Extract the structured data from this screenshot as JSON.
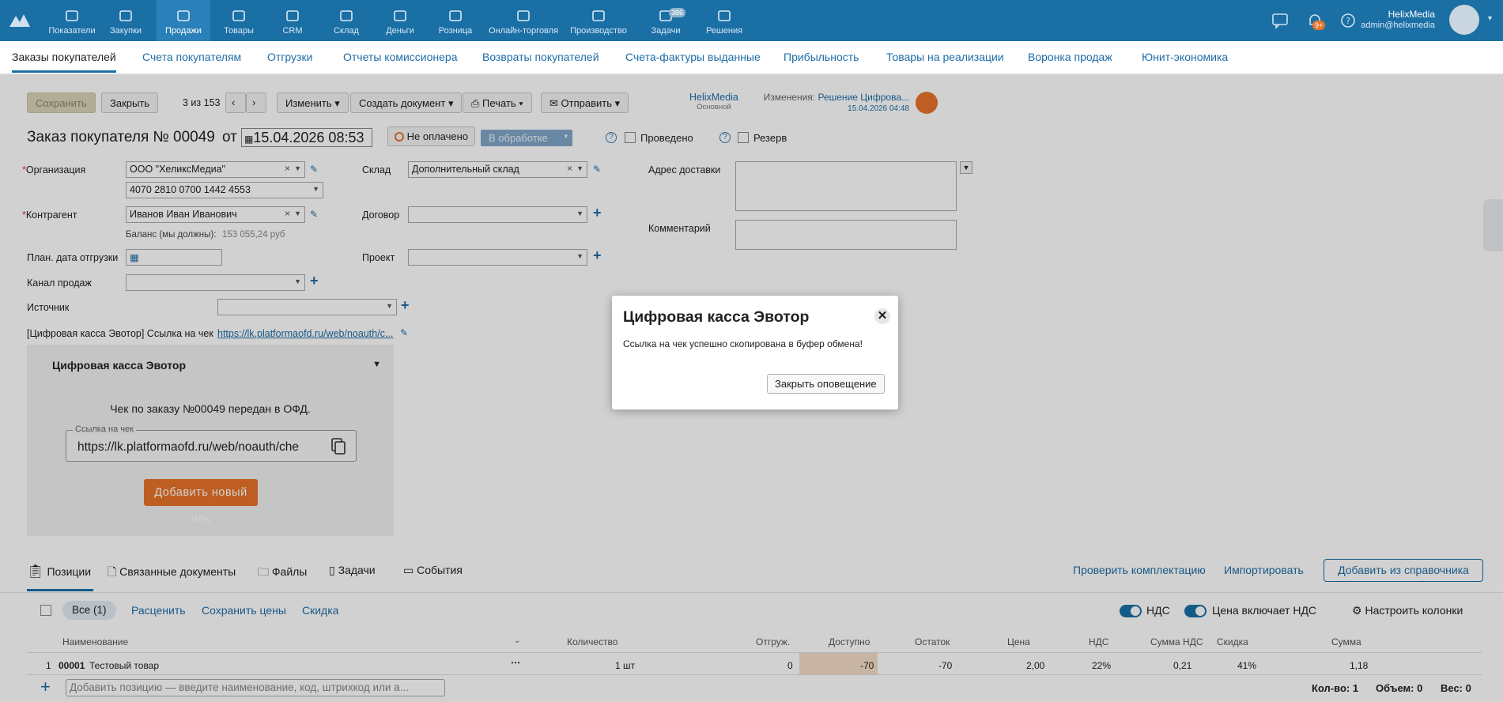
{
  "topnav": {
    "items": [
      {
        "label": "Показатели",
        "icon": "chart-icon"
      },
      {
        "label": "Закупки",
        "icon": "basket-icon"
      },
      {
        "label": "Продажи",
        "icon": "bag-icon"
      },
      {
        "label": "Товары",
        "icon": "cart-icon"
      },
      {
        "label": "CRM",
        "icon": "people-icon"
      },
      {
        "label": "Склад",
        "icon": "box-icon"
      },
      {
        "label": "Деньги",
        "icon": "wallet-icon"
      },
      {
        "label": "Розница",
        "icon": "store-icon"
      },
      {
        "label": "Онлайн-торговля",
        "icon": "online-store-icon"
      },
      {
        "label": "Производство",
        "icon": "factory-icon"
      },
      {
        "label": "Задачи",
        "icon": "tasks-icon"
      },
      {
        "label": "Решения",
        "icon": "apps-icon"
      }
    ],
    "tasks_badge": "386",
    "notif_badge": "9+",
    "user_name": "HelixMedia",
    "user_email": "admin@helixmedia"
  },
  "subnav": [
    "Заказы покупателей",
    "Счета покупателям",
    "Отгрузки",
    "Отчеты комиссионера",
    "Возвраты покупателей",
    "Счета-фактуры выданные",
    "Прибыльность",
    "Товары на реализации",
    "Воронка продаж",
    "Юнит-экономика"
  ],
  "toolbar": {
    "save": "Сохранить",
    "close": "Закрыть",
    "counter": "3 из 153",
    "change": "Изменить",
    "create_doc": "Создать документ",
    "print": "Печать",
    "send": "Отправить",
    "company": "HelixMedia",
    "company_sub": "Основной",
    "changes_label": "Изменения:",
    "changes_value": "Решение Цифрова...",
    "changes_date": "15.04.2026 04:48"
  },
  "doc": {
    "title": "Заказ покупателя №",
    "number": "00049",
    "from": "от",
    "date": "15.04.2026 08:53",
    "payment_status": "Не оплачено",
    "state": "В обработке",
    "posted": "Проведено",
    "reserve": "Резерв"
  },
  "form": {
    "org_label": "Организация",
    "org_value": "ООО \"ХеликсМедиа\"",
    "account": "4070 2810 0700 1442 4553",
    "counterparty_label": "Контрагент",
    "counterparty_value": "Иванов Иван Иванович",
    "balance_label": "Баланс (мы должны):",
    "balance_value": "153 055,24 руб",
    "ship_date_label": "План. дата отгрузки",
    "channel_label": "Канал продаж",
    "source_label": "Источник",
    "receipt_link_label": "[Цифровая касса Эвотор] Ссылка на чек",
    "receipt_link": "https://lk.platformaofd.ru/web/noauth/c...",
    "warehouse_label": "Склад",
    "warehouse_value": "Дополнительный склад",
    "contract_label": "Договор",
    "project_label": "Проект",
    "address_label": "Адрес доставки",
    "comment_label": "Комментарий"
  },
  "evotor": {
    "title": "Цифровая касса Эвотор",
    "message": "Чек по заказу №00049 передан в ОФД.",
    "link_label": "Ссылка на чек",
    "link_value": "https://lk.platformaofd.ru/web/noauth/che",
    "add_button": "Добавить новый чек"
  },
  "modal": {
    "title": "Цифровая касса Эвотор",
    "text": "Ссылка на чек успешно скопирована в буфер обмена!",
    "close_button": "Закрыть оповещение"
  },
  "bottom_tabs": [
    "Позиции",
    "Связанные документы",
    "Файлы",
    "Задачи",
    "События"
  ],
  "bottom_links": {
    "check": "Проверить комплектацию",
    "import": "Импортировать",
    "add_from": "Добавить из справочника"
  },
  "filters": {
    "all": "Все (1)",
    "reprice": "Расценить",
    "save_prices": "Сохранить цены",
    "discount": "Скидка",
    "vat": "НДС",
    "price_includes_vat": "Цена включает НДС",
    "configure": "Настроить колонки"
  },
  "table": {
    "headers": [
      "Наименование",
      "Количество",
      "Отгруж.",
      "Доступно",
      "Остаток",
      "Цена",
      "НДС",
      "Сумма НДС",
      "Скидка",
      "Сумма"
    ],
    "rows": [
      {
        "n": "1",
        "code": "00001",
        "name": "Тестовый товар",
        "qty": "1 шт",
        "shipped": "0",
        "available": "-70",
        "rest": "-70",
        "price": "2,00",
        "vat": "22%",
        "vat_sum": "0,21",
        "discount": "41%",
        "sum": "1,18"
      }
    ]
  },
  "footer": {
    "add_placeholder": "Добавить позицию — введите наименование, код, штрихкод или а...",
    "count": "Кол-во: 1",
    "volume": "Объем: 0",
    "weight": "Вес: 0"
  }
}
